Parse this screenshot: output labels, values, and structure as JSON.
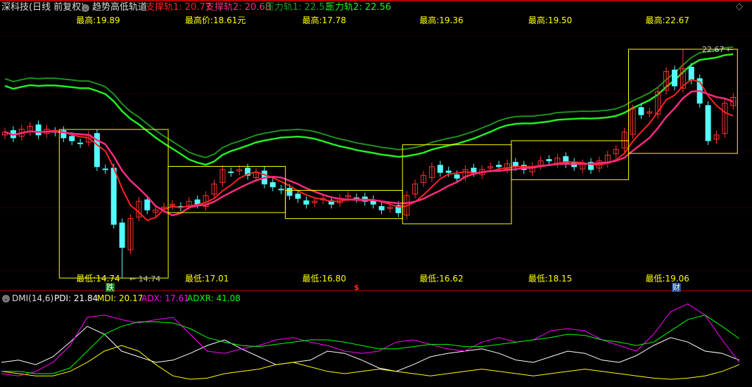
{
  "header": {
    "stock": "深科技(日线 前复权)",
    "indicator": "趋势高低轨道",
    "support1": "支撑轨1: 20.77",
    "support2": "支撑轨2: 20.68",
    "pressure1": "压力轨1: 22.53",
    "pressure2": "压力轨2: 22.56"
  },
  "dmi_header": {
    "name": "DMI(14,6)",
    "pdi": "PDI: 21.84",
    "mdi": "MDI: 20.17",
    "adx": "ADX: 17.61",
    "adxr": "ADXR: 41.08"
  },
  "markers": {
    "fall": "跌",
    "dollar": "$",
    "finance": "财",
    "low_pointer": "← 14.74",
    "high_pointer": "22.67 ←"
  },
  "colors": {
    "up": "#ff3232",
    "down": "#54ffff",
    "ma1": "#ff2020",
    "ma2": "#ff2a80",
    "band1": "#1f8f1f",
    "band2": "#22ee22",
    "box": "#ffff00",
    "pdi": "#ffffff",
    "mdi": "#ffff00",
    "adx": "#ff00ff",
    "adxr": "#00ff00"
  },
  "chart_data": [
    {
      "type": "candlestick",
      "title": "趋势高低轨道",
      "price_range": [
        14.74,
        22.67
      ],
      "closes": [
        19.8,
        19.6,
        19.9,
        20.0,
        19.7,
        19.9,
        19.8,
        19.6,
        19.5,
        19.4,
        19.7,
        18.6,
        18.5,
        16.6,
        15.8,
        16.8,
        17.4,
        17.1,
        17.1,
        17.2,
        17.3,
        17.2,
        17.4,
        17.3,
        17.6,
        18.0,
        18.5,
        18.4,
        18.5,
        18.3,
        18.4,
        18.0,
        17.9,
        17.8,
        17.6,
        17.5,
        17.3,
        17.4,
        17.5,
        17.3,
        17.5,
        17.6,
        17.5,
        17.4,
        17.3,
        17.1,
        17.2,
        17.0,
        17.6,
        18.0,
        18.3,
        18.6,
        18.4,
        18.4,
        18.2,
        18.5,
        18.4,
        18.5,
        18.6,
        18.6,
        18.7,
        18.6,
        18.5,
        18.6,
        18.8,
        18.8,
        18.9,
        18.7,
        18.6,
        18.7,
        18.5,
        18.8,
        19.0,
        19.2,
        19.8,
        20.6,
        20.4,
        20.5,
        21.2,
        21.9,
        21.4,
        22.0,
        21.6,
        20.8,
        19.5,
        19.7,
        20.8,
        21.0
      ],
      "boxes": [
        {
          "start": 7,
          "end": 19,
          "high": 19.89,
          "low": 14.74,
          "high_label": "最高:19.89",
          "low_label": "最低:14.74"
        },
        {
          "start": 20,
          "end": 33,
          "high": 18.61,
          "low": 17.01,
          "high_label": "最高价:18.61元",
          "low_label": "最低:17.01"
        },
        {
          "start": 34,
          "end": 47,
          "high": 17.78,
          "low": 16.8,
          "high_label": "最高:17.78",
          "low_label": "最低:16.80"
        },
        {
          "start": 48,
          "end": 60,
          "high": 19.36,
          "low": 16.62,
          "high_label": "最高:19.36",
          "low_label": "最低:16.62"
        },
        {
          "start": 61,
          "end": 74,
          "high": 19.5,
          "low": 18.15,
          "high_label": "最高:19.50",
          "low_label": "最低:18.15"
        },
        {
          "start": 75,
          "end": 87,
          "high": 22.67,
          "low": 19.06,
          "high_label": "最高:22.67",
          "low_label": "最低:19.06"
        }
      ]
    },
    {
      "type": "line",
      "title": "DMI(14,6)",
      "ylim": [
        0,
        70
      ],
      "series": [
        {
          "name": "PDI",
          "values": [
            20,
            22,
            18,
            25,
            38,
            52,
            45,
            30,
            25,
            20,
            22,
            28,
            35,
            40,
            32,
            25,
            18,
            20,
            22,
            30,
            28,
            22,
            15,
            12,
            18,
            25,
            28,
            30,
            32,
            28,
            22,
            20,
            25,
            30,
            28,
            22,
            20,
            26,
            35,
            42,
            38,
            30,
            28,
            22
          ]
        },
        {
          "name": "MDI",
          "values": [
            12,
            10,
            8,
            8,
            12,
            20,
            30,
            35,
            30,
            18,
            8,
            5,
            6,
            10,
            12,
            14,
            18,
            20,
            16,
            12,
            10,
            12,
            14,
            12,
            10,
            8,
            10,
            12,
            14,
            12,
            10,
            8,
            10,
            12,
            14,
            12,
            10,
            8,
            6,
            5,
            6,
            8,
            12,
            18
          ]
        },
        {
          "name": "ADX",
          "values": [
            10,
            8,
            12,
            20,
            35,
            60,
            62,
            58,
            55,
            58,
            60,
            45,
            30,
            28,
            32,
            35,
            40,
            42,
            38,
            35,
            30,
            28,
            30,
            38,
            40,
            36,
            32,
            30,
            38,
            42,
            38,
            40,
            48,
            50,
            48,
            40,
            35,
            30,
            45,
            65,
            72,
            62,
            40,
            20
          ]
        },
        {
          "name": "ADXR",
          "values": [
            12,
            12,
            10,
            10,
            15,
            30,
            45,
            52,
            56,
            56,
            55,
            50,
            42,
            38,
            35,
            34,
            36,
            38,
            40,
            40,
            38,
            35,
            32,
            32,
            34,
            36,
            36,
            34,
            34,
            36,
            38,
            40,
            42,
            45,
            44,
            40,
            38,
            35,
            38,
            48,
            58,
            62,
            52,
            41
          ]
        }
      ]
    }
  ]
}
